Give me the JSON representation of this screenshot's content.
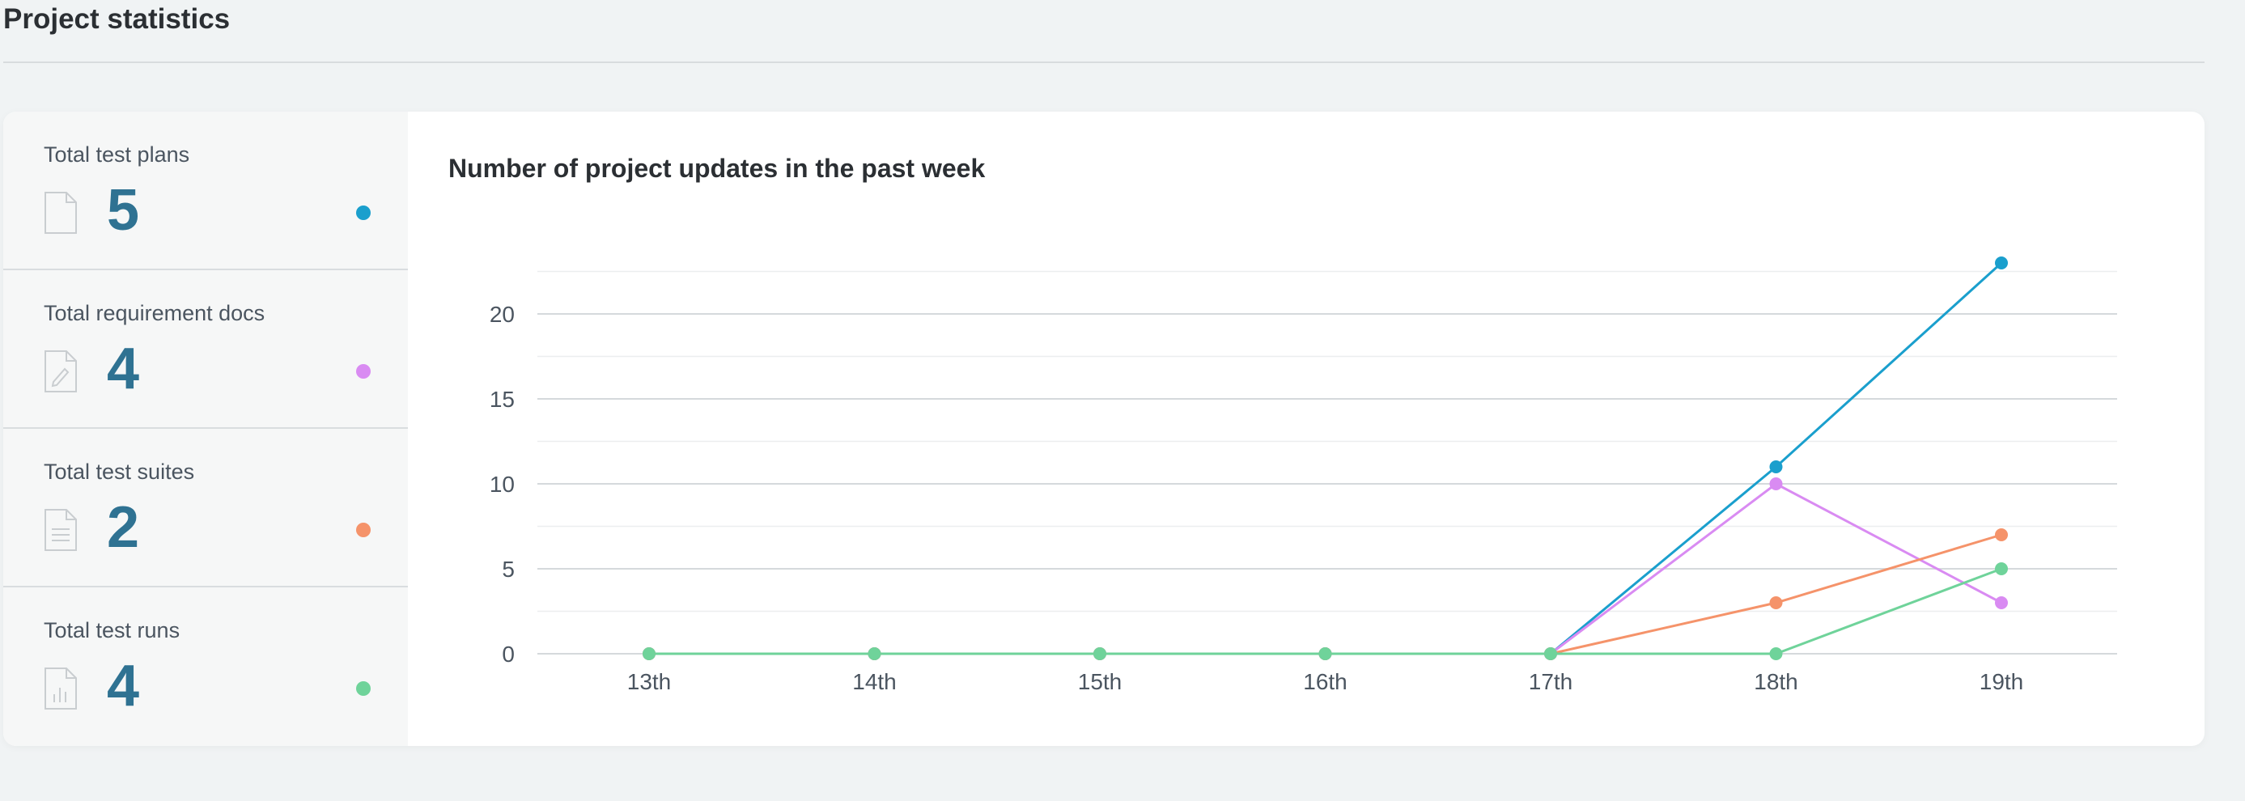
{
  "page": {
    "title": "Project statistics"
  },
  "stats": [
    {
      "label": "Total test plans",
      "value": "5",
      "icon": "document-icon",
      "color": "#1a9fcd"
    },
    {
      "label": "Total requirement docs",
      "value": "4",
      "icon": "document-edit-icon",
      "color": "#d98bf2"
    },
    {
      "label": "Total test suites",
      "value": "2",
      "icon": "document-lines-icon",
      "color": "#f5936a"
    },
    {
      "label": "Total test runs",
      "value": "4",
      "icon": "document-chart-icon",
      "color": "#6fd39a"
    }
  ],
  "chart_data": {
    "type": "line",
    "title": "Number of project updates in the past week",
    "xlabel": "",
    "ylabel": "",
    "categories": [
      "13th",
      "14th",
      "15th",
      "16th",
      "17th",
      "18th",
      "19th"
    ],
    "y_ticks": [
      0,
      5,
      10,
      15,
      20
    ],
    "ylim": [
      0,
      22.5
    ],
    "grid": true,
    "legend": "none",
    "series": [
      {
        "color": "#1a9fcd",
        "values": [
          0,
          0,
          0,
          0,
          0,
          11,
          23
        ]
      },
      {
        "color": "#d98bf2",
        "values": [
          0,
          0,
          0,
          0,
          0,
          10,
          3
        ]
      },
      {
        "color": "#f5936a",
        "values": [
          0,
          0,
          0,
          0,
          0,
          3,
          7
        ]
      },
      {
        "color": "#6fd39a",
        "values": [
          0,
          0,
          0,
          0,
          0,
          0,
          5
        ]
      }
    ]
  }
}
